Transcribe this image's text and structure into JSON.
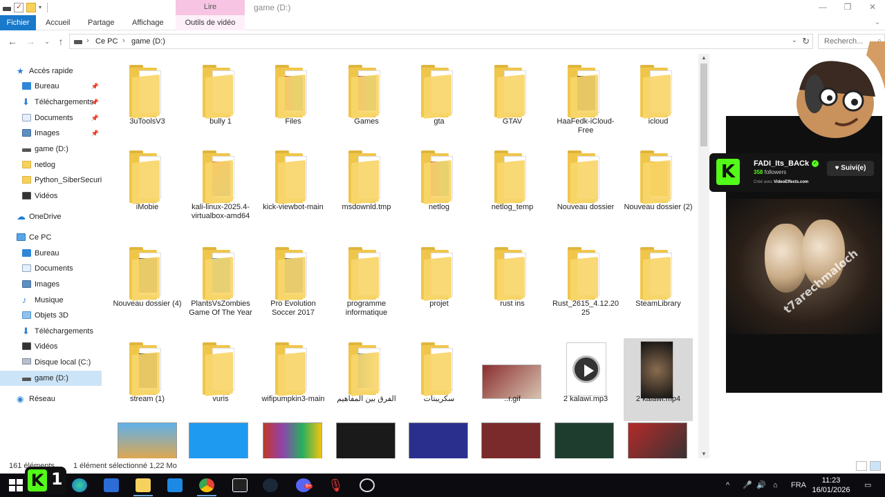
{
  "window": {
    "title": "game (D:)",
    "context_tab": "Lire",
    "controls": {
      "minimize": "—",
      "maximize": "❐",
      "close": "✕"
    }
  },
  "ribbon": {
    "tabs": [
      "Fichier",
      "Accueil",
      "Partage",
      "Affichage",
      "Outils de vidéo"
    ]
  },
  "address": {
    "crumbs": [
      "Ce PC",
      "game (D:)"
    ],
    "search_placeholder": "Recherch..."
  },
  "nav": {
    "items": [
      {
        "label": "Accès rapide",
        "icon": "star-icon",
        "pinned": false
      },
      {
        "label": "Bureau",
        "icon": "desktop-icon",
        "pinned": true
      },
      {
        "label": "Téléchargements",
        "icon": "download-icon",
        "pinned": true
      },
      {
        "label": "Documents",
        "icon": "documents-icon",
        "pinned": true
      },
      {
        "label": "Images",
        "icon": "images-icon",
        "pinned": true
      },
      {
        "label": "game (D:)",
        "icon": "drive-icon",
        "pinned": false
      },
      {
        "label": "netlog",
        "icon": "folder-icon",
        "pinned": false
      },
      {
        "label": "Python_SiberSecurit",
        "icon": "folder-icon",
        "pinned": false
      },
      {
        "label": "Vidéos",
        "icon": "video-icon",
        "pinned": false
      },
      {
        "label": "OneDrive",
        "icon": "cloud-icon",
        "pinned": false
      },
      {
        "label": "Ce PC",
        "icon": "pc-icon",
        "pinned": false
      },
      {
        "label": "Bureau",
        "icon": "desktop-icon",
        "pinned": false
      },
      {
        "label": "Documents",
        "icon": "documents-icon",
        "pinned": false
      },
      {
        "label": "Images",
        "icon": "images-icon",
        "pinned": false
      },
      {
        "label": "Musique",
        "icon": "music-icon",
        "pinned": false
      },
      {
        "label": "Objets 3D",
        "icon": "objects3d-icon",
        "pinned": false
      },
      {
        "label": "Téléchargements",
        "icon": "download-icon",
        "pinned": false
      },
      {
        "label": "Vidéos",
        "icon": "video-icon",
        "pinned": false
      },
      {
        "label": "Disque local (C:)",
        "icon": "disk-icon",
        "pinned": false
      },
      {
        "label": "game (D:)",
        "icon": "drive-icon",
        "pinned": false
      },
      {
        "label": "Réseau",
        "icon": "network-icon",
        "pinned": false
      }
    ],
    "pin_glyph": "📌"
  },
  "files": {
    "rows": [
      [
        "3uToolsV3",
        "bully 1",
        "Files",
        "Games",
        "gta",
        "GTAV",
        "HaaFedk-iCloud-Free",
        "icloud"
      ],
      [
        "iMobie",
        "kali-linux-2025.4-virtualbox-amd64",
        "kick-viewbot-main",
        "msdownld.tmp",
        "netlog",
        "netlog_temp",
        "Nouveau dossier",
        "Nouveau dossier (2)"
      ],
      [
        "Nouveau dossier (4)",
        "PlantsVsZombies Game Of The Year",
        "Pro Evolution Soccer 2017",
        "programme informatique",
        "projet",
        "rust ins",
        "Rust_2615_4.12.2025",
        "SteamLibrary"
      ],
      [
        "stream (1)",
        "vuris",
        "wifipumpkin3-main",
        "الفرق بين المفاهيم",
        "سكريبتات",
        "..r.gif",
        "2 kalawi.mp3",
        "2 kalawi.mp4"
      ]
    ],
    "selected": "2 kalawi.mp4"
  },
  "status": {
    "count": "161 éléments",
    "selection": "1 élément sélectionné  1,22 Mo"
  },
  "overlay": {
    "streamer": "FADI_Its_BACk",
    "followers_count": "358",
    "followers_label": "followers",
    "credit_prefix": "Créé avec",
    "credit_brand": "VideoEffects.com",
    "follow_button": "Suivi(e)",
    "watermark": "t7arechmaloch",
    "badge_number": "1"
  },
  "taskbar": {
    "language": "FRA",
    "time": "11:23",
    "date": "16/01/2026",
    "discord_badge": "9+"
  },
  "colors": {
    "accent": "#1979ca",
    "context_tab": "#f7c5e3",
    "kick_green": "#53fc18",
    "folder": "#f0c64a",
    "selection": "#cce4f7"
  }
}
